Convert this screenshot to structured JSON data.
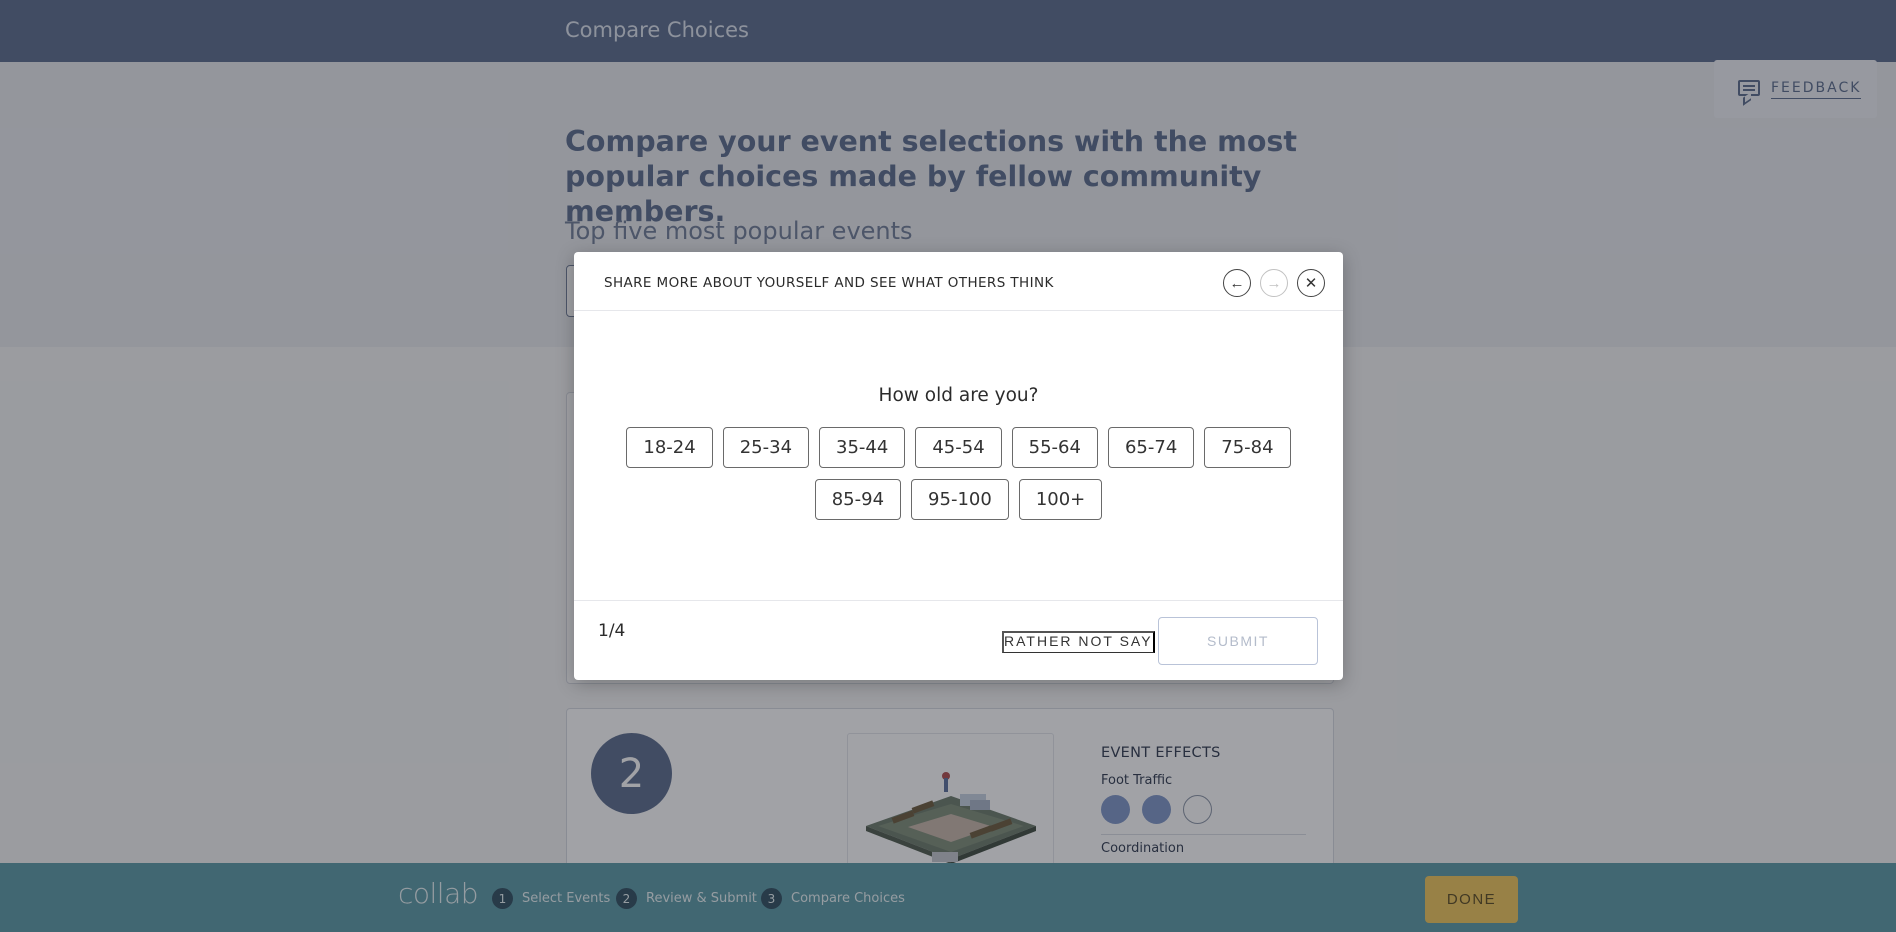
{
  "header": {
    "title": "Compare Choices"
  },
  "hero": {
    "heading": "Compare your event selections with the most popular choices made by fellow community members.",
    "subheading": "Top five most popular events"
  },
  "feedback": {
    "label": "FEEDBACK",
    "icon": "comment-icon"
  },
  "cards": [
    {
      "rank": "2",
      "effects_title": "EVENT EFFECTS",
      "effects": [
        {
          "label": "Foot Traffic",
          "filled": 2,
          "total": 3
        },
        {
          "label": "Coordination"
        }
      ]
    }
  ],
  "modal": {
    "title": "SHARE MORE ABOUT YOURSELF AND SEE WHAT OTHERS THINK",
    "question": "How old are you?",
    "options_row1": [
      "18-24",
      "25-34",
      "35-44",
      "45-54",
      "55-64",
      "65-74",
      "75-84"
    ],
    "options_row2": [
      "85-94",
      "95-100",
      "100+"
    ],
    "progress": "1/4",
    "rather_not_say": "RATHER NOT SAY",
    "submit": "SUBMIT",
    "prev_icon": "arrow-left-icon",
    "next_icon": "arrow-right-icon",
    "close_icon": "close-icon"
  },
  "footer": {
    "logo": "collab",
    "steps": [
      {
        "num": "1",
        "label": "Select Events"
      },
      {
        "num": "2",
        "label": "Review & Submit"
      },
      {
        "num": "3",
        "label": "Compare Choices"
      }
    ],
    "done": "DONE"
  },
  "colors": {
    "header": "#5b6c8c",
    "footer": "#5b9aa6",
    "done": "#f0c75a",
    "accent_dot": "#7f97c8"
  }
}
